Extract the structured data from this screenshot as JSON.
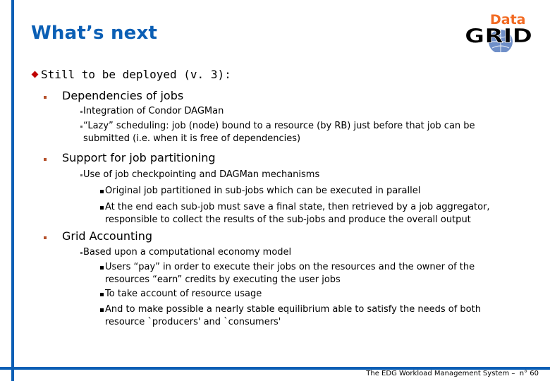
{
  "slide": {
    "title": "What’s next",
    "footer": "The EDG Workload Management System –  n° 60",
    "logo": {
      "top_text": "Data",
      "bottom_text": "GRID",
      "top_color": "#f26a22",
      "bottom_color": "#000000",
      "globe_color": "#6f8fc8"
    },
    "accent_color": "#0b5fb5",
    "level1": {
      "text": "Still to be deployed (v. 3):"
    },
    "sections": [
      {
        "heading": "Dependencies of jobs",
        "items": [
          {
            "text": "Integration of Condor DAGMan"
          },
          {
            "line1": "“Lazy” scheduling: job (node) bound to a resource (by RB) just before that job can be",
            "line2": "submitted (i.e. when it is free of dependencies)"
          }
        ]
      },
      {
        "heading": "Support for job partitioning",
        "items": [
          {
            "text": "Use of job checkpointing and DAGMan mechanisms",
            "subitems": [
              {
                "text": "Original job partitioned in sub-jobs which can be executed in parallel"
              },
              {
                "line1": "At the end each sub-job must save a final state, then retrieved by a job aggregator,",
                "line2": "responsible to collect the results of the sub-jobs and produce the overall output"
              }
            ]
          }
        ]
      },
      {
        "heading": "Grid Accounting",
        "items": [
          {
            "text": "Based upon a computational economy model",
            "subitems": [
              {
                "line1": "Users “pay” in order to execute their jobs on the resources and the owner of the",
                "line2": "resources “earn” credits by executing the user jobs"
              },
              {
                "text": "To take account of resource usage"
              },
              {
                "line1": "And to make possible a nearly stable equilibrium able to satisfy the needs of both",
                "line2": "resource `producers' and `consumers'"
              }
            ]
          }
        ]
      }
    ]
  }
}
